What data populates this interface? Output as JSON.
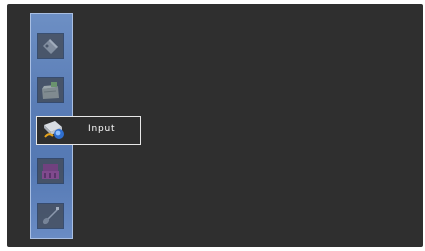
{
  "menu": {
    "items": [
      {
        "icon": "tag-label-icon"
      },
      {
        "icon": "box-tray-icon"
      },
      {
        "icon": "input-source-icon",
        "label": "Input",
        "selected": true
      },
      {
        "icon": "theater-seats-icon"
      },
      {
        "icon": "guitar-music-icon"
      }
    ]
  },
  "colors": {
    "screen_background": "#2f2f2f",
    "panel_blue": "#5a7db6",
    "selection_border": "#e8e8e8",
    "label_text": "#ffffff"
  }
}
